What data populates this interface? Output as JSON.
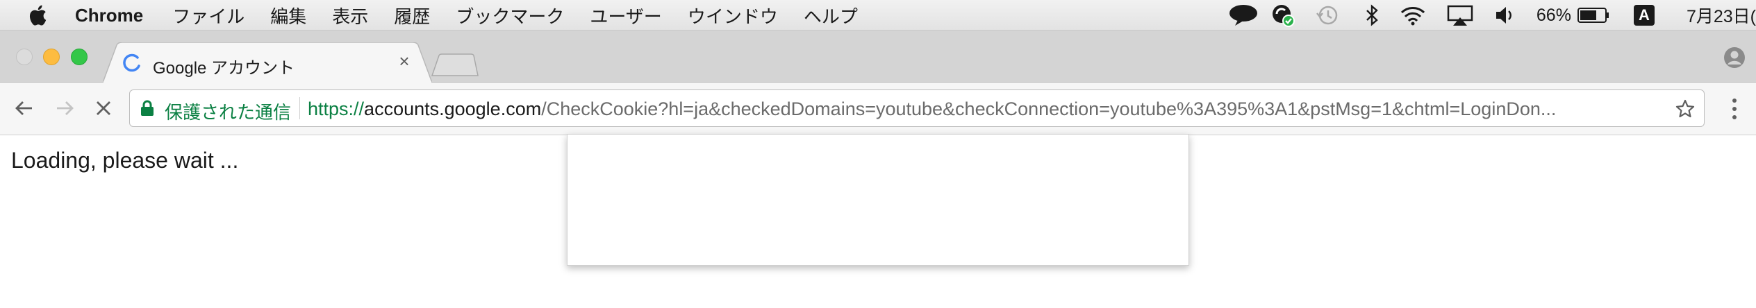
{
  "menubar": {
    "apple_icon": "apple-icon",
    "app_name": "Chrome",
    "items": [
      "ファイル",
      "編集",
      "表示",
      "履歴",
      "ブックマーク",
      "ユーザー",
      "ウインドウ",
      "ヘルプ"
    ],
    "status": {
      "battery": "66%",
      "input_source": "A",
      "date": "7月23日("
    }
  },
  "tab": {
    "title": "Google アカウント",
    "close_glyph": "×"
  },
  "toolbar": {
    "security_label": "保護された通信",
    "url_scheme": "https://",
    "url_host": "accounts.google.com",
    "url_path": "/CheckCookie?hl=ja&checkedDomains=youtube&checkConnection=youtube%3A395%3A1&pstMsg=1&chtml=LoginDon..."
  },
  "page": {
    "loading_text": "Loading, please wait ..."
  },
  "colors": {
    "secure_green": "#0b8043",
    "spinner_blue": "#4285f4",
    "traffic_min": "#fdbc40",
    "traffic_max": "#33c748"
  }
}
